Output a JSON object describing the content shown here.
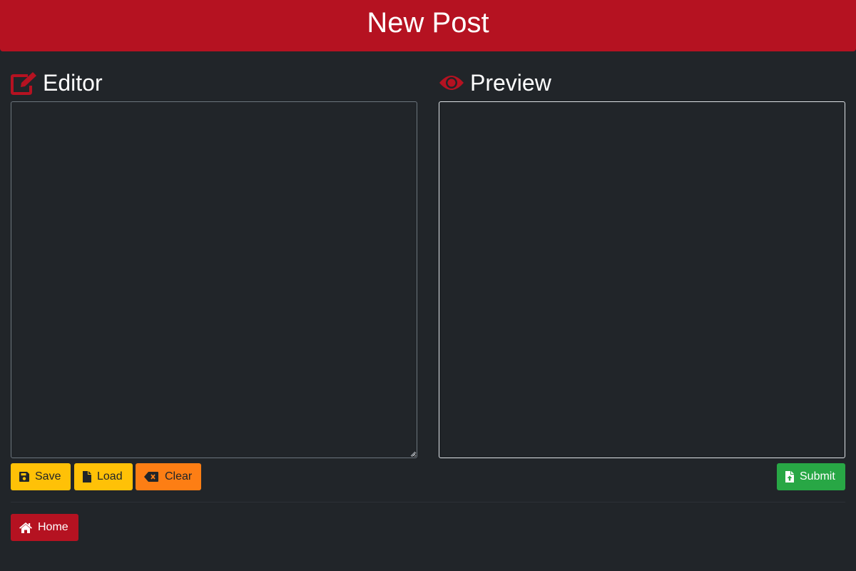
{
  "header": {
    "title": "New Post"
  },
  "editor": {
    "title": "Editor",
    "icon": "edit-icon",
    "content": ""
  },
  "preview": {
    "title": "Preview",
    "icon": "eye-icon",
    "content": ""
  },
  "toolbar": {
    "save_label": "Save",
    "load_label": "Load",
    "clear_label": "Clear",
    "submit_label": "Submit"
  },
  "nav": {
    "home_label": "Home"
  },
  "colors": {
    "background": "#212529",
    "brand": "#b51221",
    "warning": "#ffc107",
    "orange": "#fd7e14",
    "success": "#28a745"
  }
}
